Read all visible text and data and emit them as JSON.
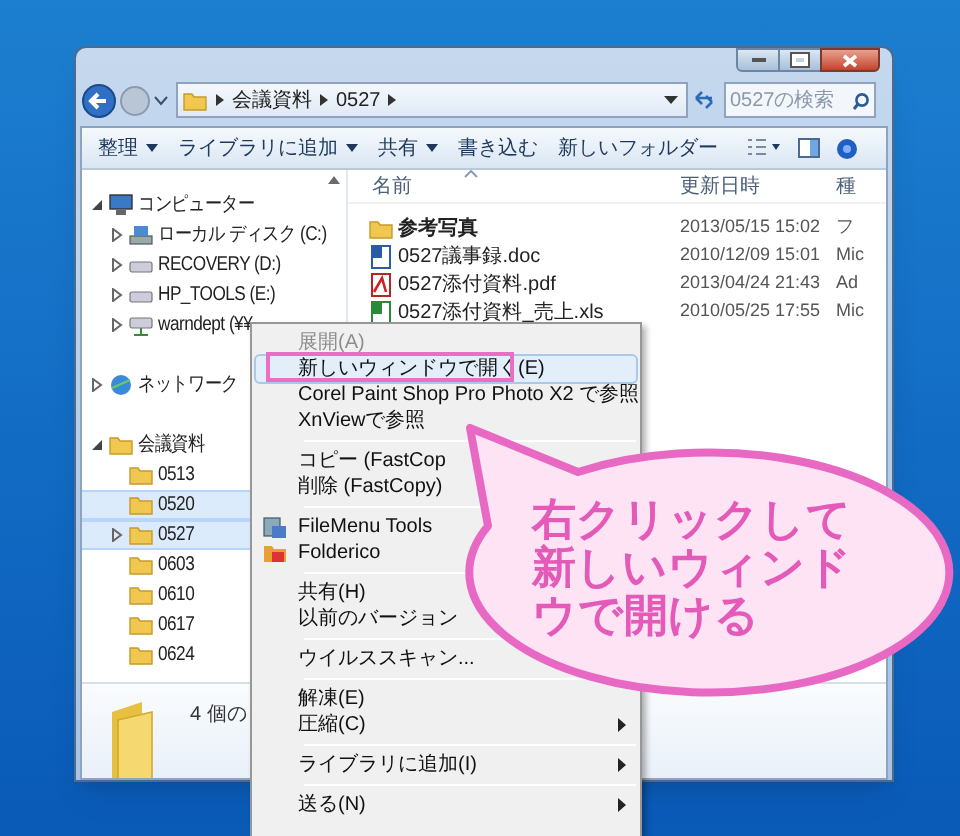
{
  "address": {
    "path": [
      "会議資料",
      "0527"
    ]
  },
  "search": {
    "placeholder": "0527の検索"
  },
  "toolbar": [
    {
      "label": "整理",
      "dropdown": true
    },
    {
      "label": "ライブラリに追加",
      "dropdown": true
    },
    {
      "label": "共有",
      "dropdown": true
    },
    {
      "label": "書き込む",
      "dropdown": false
    },
    {
      "label": "新しいフォルダー",
      "dropdown": false
    }
  ],
  "nav": [
    {
      "label": "コンピューター",
      "kind": "computer",
      "expanded": true,
      "selected": false,
      "children": [
        {
          "label": "ローカル ディスク (C:)",
          "kind": "disk",
          "expanded": false,
          "selected": false
        },
        {
          "label": "RECOVERY (D:)",
          "kind": "drive",
          "expanded": false,
          "selected": false
        },
        {
          "label": "HP_TOOLS (E:)",
          "kind": "drive",
          "expanded": false,
          "selected": false
        },
        {
          "label": "warndept (¥¥",
          "kind": "netdrive",
          "expanded": false,
          "selected": false
        }
      ]
    },
    {
      "label": "ネットワーク",
      "kind": "network",
      "expanded": false,
      "selected": false
    },
    {
      "label": "会議資料",
      "kind": "folder",
      "expanded": true,
      "selected": false,
      "children": [
        {
          "label": "0513",
          "kind": "folder",
          "selected": false
        },
        {
          "label": "0520",
          "kind": "folder",
          "selected": true
        },
        {
          "label": "0527",
          "kind": "folder",
          "expanded": false,
          "selected": true
        },
        {
          "label": "0603",
          "kind": "folder",
          "selected": false
        },
        {
          "label": "0610",
          "kind": "folder",
          "selected": false
        },
        {
          "label": "0617",
          "kind": "folder",
          "selected": false
        },
        {
          "label": "0624",
          "kind": "folder",
          "selected": false
        }
      ]
    }
  ],
  "columns": [
    "名前",
    "更新日時",
    "種"
  ],
  "files": [
    {
      "name": "参考写真",
      "kind": "folder",
      "modified": "2013/05/15 15:02",
      "type": "フ"
    },
    {
      "name": "0527議事録.doc",
      "kind": "doc",
      "modified": "2010/12/09 15:01",
      "type": "Mic"
    },
    {
      "name": "0527添付資料.pdf",
      "kind": "pdf",
      "modified": "2013/04/24 21:43",
      "type": "Ad"
    },
    {
      "name": "0527添付資料_売上.xls",
      "kind": "xls",
      "modified": "2010/05/25 17:55",
      "type": "Mic"
    }
  ],
  "status": "4 個の",
  "menu": [
    {
      "kind": "item",
      "label": "展開(A)",
      "disabled": true,
      "selected": false,
      "submenu": false
    },
    {
      "kind": "item",
      "label": "新しいウィンドウで開く(E)",
      "disabled": false,
      "selected": true,
      "submenu": false
    },
    {
      "kind": "item",
      "label": "Corel Paint Shop Pro Photo X2 で参照",
      "disabled": false,
      "selected": false,
      "submenu": false
    },
    {
      "kind": "item",
      "label": "XnViewで参照",
      "disabled": false,
      "selected": false,
      "submenu": false
    },
    {
      "kind": "separator"
    },
    {
      "kind": "item",
      "label": "コピー (FastCop",
      "disabled": false,
      "selected": false,
      "submenu": false
    },
    {
      "kind": "item",
      "label": "削除 (FastCopy)",
      "disabled": false,
      "selected": false,
      "submenu": false
    },
    {
      "kind": "separator"
    },
    {
      "kind": "item",
      "label": "FileMenu Tools",
      "disabled": false,
      "selected": false,
      "submenu": false
    },
    {
      "kind": "item",
      "label": "Folderico",
      "disabled": false,
      "selected": false,
      "submenu": false
    },
    {
      "kind": "separator"
    },
    {
      "kind": "item",
      "label": "共有(H)",
      "disabled": false,
      "selected": false,
      "submenu": false
    },
    {
      "kind": "item",
      "label": "以前のバージョン",
      "disabled": false,
      "selected": false,
      "submenu": false
    },
    {
      "kind": "separator"
    },
    {
      "kind": "item",
      "label": "ウイルススキャン...",
      "disabled": false,
      "selected": false,
      "submenu": false
    },
    {
      "kind": "separator"
    },
    {
      "kind": "item",
      "label": "解凍(E)",
      "disabled": false,
      "selected": false,
      "submenu": false
    },
    {
      "kind": "item",
      "label": "圧縮(C)",
      "disabled": false,
      "selected": false,
      "submenu": true
    },
    {
      "kind": "separator"
    },
    {
      "kind": "item",
      "label": "ライブラリに追加(I)",
      "disabled": false,
      "selected": false,
      "submenu": true
    },
    {
      "kind": "separator"
    },
    {
      "kind": "item",
      "label": "送る(N)",
      "disabled": false,
      "selected": false,
      "submenu": true
    }
  ],
  "callout": {
    "lines": [
      "右クリックして",
      "新しいウィンド",
      "ウで開ける"
    ]
  }
}
